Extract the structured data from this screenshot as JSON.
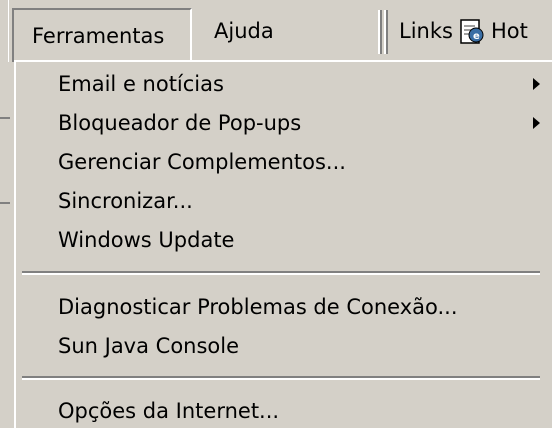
{
  "menubar": {
    "tools_label": "Ferramentas",
    "help_label": "Ajuda",
    "links_label": "Links",
    "hot_label": "Hot"
  },
  "tools_menu": {
    "items": [
      {
        "label": "Email e notícias",
        "submenu": true
      },
      {
        "label": "Bloqueador de Pop-ups",
        "submenu": true
      },
      {
        "label": "Gerenciar Complementos...",
        "submenu": false
      },
      {
        "label": "Sincronizar...",
        "submenu": false
      },
      {
        "label": "Windows Update",
        "submenu": false
      },
      {
        "label": "Diagnosticar Problemas de Conexão...",
        "submenu": false
      },
      {
        "label": "Sun Java Console",
        "submenu": false
      },
      {
        "label": "Opções da Internet...",
        "submenu": false
      }
    ]
  },
  "icons": {
    "links_page": "ie-page-icon",
    "submenu_arrow": "submenu-arrow-icon"
  },
  "colors": {
    "face": "#d4d0c8",
    "shadow": "#808080",
    "highlight": "#ffffff",
    "text": "#000000"
  }
}
